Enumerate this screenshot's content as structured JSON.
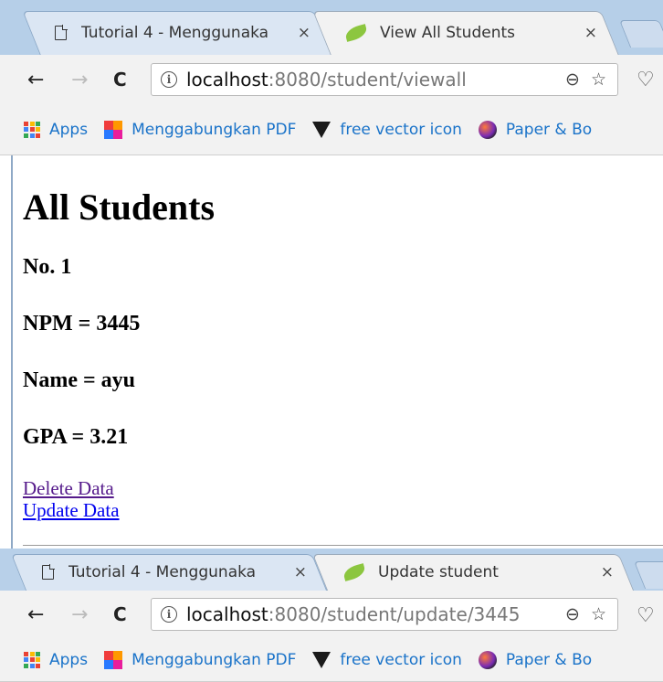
{
  "window1": {
    "tabs": [
      {
        "title": "Tutorial 4 - Menggunaka",
        "close": "×",
        "icon": "document-icon",
        "active": false
      },
      {
        "title": "View All Students",
        "close": "×",
        "icon": "spring-leaf-icon",
        "active": true
      }
    ],
    "address": {
      "host": "localhost",
      "path": ":8080/student/viewall"
    },
    "bookmarks": [
      {
        "label": "Apps",
        "icon": "apps-grid-icon"
      },
      {
        "label": "Menggabungkan PDF",
        "icon": "color-blocks-icon"
      },
      {
        "label": "free vector icon",
        "icon": "vector-logo-icon"
      },
      {
        "label": "Paper & Bo",
        "icon": "globe-icon"
      }
    ],
    "content": {
      "heading": "All Students",
      "number": "No. 1",
      "npm": "NPM = 3445",
      "name": "Name = ayu",
      "gpa": "GPA = 3.21",
      "delete_link": "Delete Data",
      "update_link": "Update Data"
    }
  },
  "window2": {
    "tabs": [
      {
        "title": "Tutorial 4 - Menggunaka",
        "close": "×",
        "icon": "document-icon",
        "active": false
      },
      {
        "title": "Update student",
        "close": "×",
        "icon": "spring-leaf-icon",
        "active": true
      }
    ],
    "address": {
      "host": "localhost",
      "path": ":8080/student/update/3445"
    },
    "bookmarks": [
      {
        "label": "Apps",
        "icon": "apps-grid-icon"
      },
      {
        "label": "Menggabungkan PDF",
        "icon": "color-blocks-icon"
      },
      {
        "label": "free vector icon",
        "icon": "vector-logo-icon"
      },
      {
        "label": "Paper & Bo",
        "icon": "globe-icon"
      }
    ]
  },
  "nav_glyphs": {
    "back": "←",
    "forward": "→",
    "reload": "C",
    "info": "i",
    "zoom": "⊖",
    "star": "☆",
    "heart": "♡"
  },
  "colors": {
    "tabstrip": "#b6cfe8",
    "toolbar": "#f2f2f2",
    "link": "#0000ee",
    "visited": "#551a8b",
    "bookmark_text": "#1a73c9"
  }
}
